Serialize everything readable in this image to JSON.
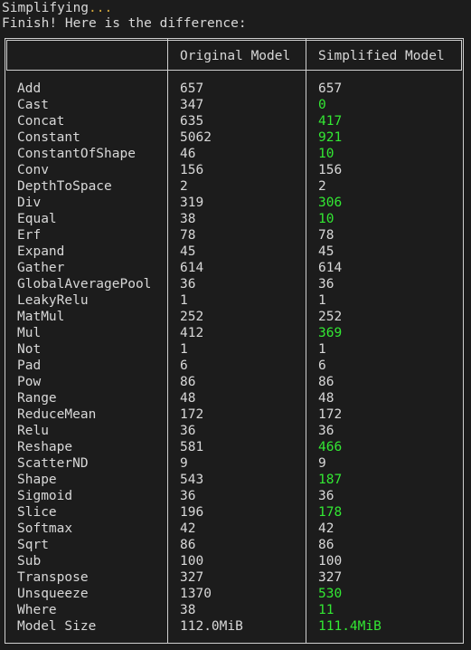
{
  "terminal": {
    "line1_text": "Simplifying",
    "line1_ellipsis": "...",
    "line2": "Finish! Here is the difference:"
  },
  "table": {
    "headers": {
      "op": "",
      "original": "Original Model",
      "simplified": "Simplified Model"
    },
    "rows": [
      {
        "op": "Add",
        "original": "657",
        "simplified": "657",
        "changed": false
      },
      {
        "op": "Cast",
        "original": "347",
        "simplified": "0",
        "changed": true
      },
      {
        "op": "Concat",
        "original": "635",
        "simplified": "417",
        "changed": true
      },
      {
        "op": "Constant",
        "original": "5062",
        "simplified": "921",
        "changed": true
      },
      {
        "op": "ConstantOfShape",
        "original": "46",
        "simplified": "10",
        "changed": true
      },
      {
        "op": "Conv",
        "original": "156",
        "simplified": "156",
        "changed": false
      },
      {
        "op": "DepthToSpace",
        "original": "2",
        "simplified": "2",
        "changed": false
      },
      {
        "op": "Div",
        "original": "319",
        "simplified": "306",
        "changed": true
      },
      {
        "op": "Equal",
        "original": "38",
        "simplified": "10",
        "changed": true
      },
      {
        "op": "Erf",
        "original": "78",
        "simplified": "78",
        "changed": false
      },
      {
        "op": "Expand",
        "original": "45",
        "simplified": "45",
        "changed": false
      },
      {
        "op": "Gather",
        "original": "614",
        "simplified": "614",
        "changed": false
      },
      {
        "op": "GlobalAveragePool",
        "original": "36",
        "simplified": "36",
        "changed": false
      },
      {
        "op": "LeakyRelu",
        "original": "1",
        "simplified": "1",
        "changed": false
      },
      {
        "op": "MatMul",
        "original": "252",
        "simplified": "252",
        "changed": false
      },
      {
        "op": "Mul",
        "original": "412",
        "simplified": "369",
        "changed": true
      },
      {
        "op": "Not",
        "original": "1",
        "simplified": "1",
        "changed": false
      },
      {
        "op": "Pad",
        "original": "6",
        "simplified": "6",
        "changed": false
      },
      {
        "op": "Pow",
        "original": "86",
        "simplified": "86",
        "changed": false
      },
      {
        "op": "Range",
        "original": "48",
        "simplified": "48",
        "changed": false
      },
      {
        "op": "ReduceMean",
        "original": "172",
        "simplified": "172",
        "changed": false
      },
      {
        "op": "Relu",
        "original": "36",
        "simplified": "36",
        "changed": false
      },
      {
        "op": "Reshape",
        "original": "581",
        "simplified": "466",
        "changed": true
      },
      {
        "op": "ScatterND",
        "original": "9",
        "simplified": "9",
        "changed": false
      },
      {
        "op": "Shape",
        "original": "543",
        "simplified": "187",
        "changed": true
      },
      {
        "op": "Sigmoid",
        "original": "36",
        "simplified": "36",
        "changed": false
      },
      {
        "op": "Slice",
        "original": "196",
        "simplified": "178",
        "changed": true
      },
      {
        "op": "Softmax",
        "original": "42",
        "simplified": "42",
        "changed": false
      },
      {
        "op": "Sqrt",
        "original": "86",
        "simplified": "86",
        "changed": false
      },
      {
        "op": "Sub",
        "original": "100",
        "simplified": "100",
        "changed": false
      },
      {
        "op": "Transpose",
        "original": "327",
        "simplified": "327",
        "changed": false
      },
      {
        "op": "Unsqueeze",
        "original": "1370",
        "simplified": "530",
        "changed": true
      },
      {
        "op": "Where",
        "original": "38",
        "simplified": "11",
        "changed": true
      },
      {
        "op": "Model Size",
        "original": "112.0MiB",
        "simplified": "111.4MiB",
        "changed": true
      }
    ]
  },
  "colors": {
    "background": "#1c1c1c",
    "text": "#d8d8d8",
    "changed_value": "#33e833",
    "ellipsis": "#d2a63a",
    "border": "#cfcfcf"
  }
}
